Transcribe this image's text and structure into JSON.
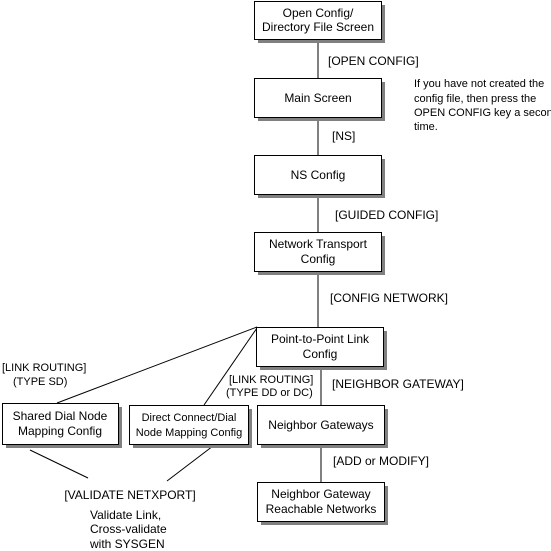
{
  "boxes": {
    "open_config": [
      "Open Config/",
      "Directory File Screen"
    ],
    "main_screen": [
      "Main Screen"
    ],
    "ns_config": [
      "NS Config"
    ],
    "network_transport": [
      "Network Transport",
      "Config"
    ],
    "point_to_point": [
      "Point-to-Point Link",
      "Config"
    ],
    "shared_dial": [
      "Shared Dial Node",
      "Mapping Config"
    ],
    "direct_connect": [
      "Direct Connect/Dial",
      "Node Mapping Config"
    ],
    "neighbor_gateways": [
      "Neighbor Gateways"
    ],
    "reachable_networks": [
      "Neighbor Gateway",
      "Reachable Networks"
    ]
  },
  "labels": {
    "open_config_key": "[OPEN CONFIG]",
    "ns_key": "[NS]",
    "guided_config_key": "[GUIDED CONFIG]",
    "config_network_key": "[CONFIG NETWORK]",
    "neighbor_gateway_key": "[NEIGHBOR GATEWAY]",
    "add_modify_key": "[ADD or MODIFY]",
    "link_routing_sd": [
      "[LINK ROUTING]",
      "(TYPE SD)"
    ],
    "link_routing_dd": [
      "[LINK ROUTING]",
      "(TYPE DD or DC)"
    ],
    "validate_netxport": "[VALIDATE NETXPORT]",
    "validate_note": [
      "Validate Link,",
      "Cross-validate",
      "with SYSGEN"
    ]
  },
  "note": [
    "If you have not created the",
    "config file, then press the",
    "OPEN CONFIG key a second",
    "time."
  ]
}
